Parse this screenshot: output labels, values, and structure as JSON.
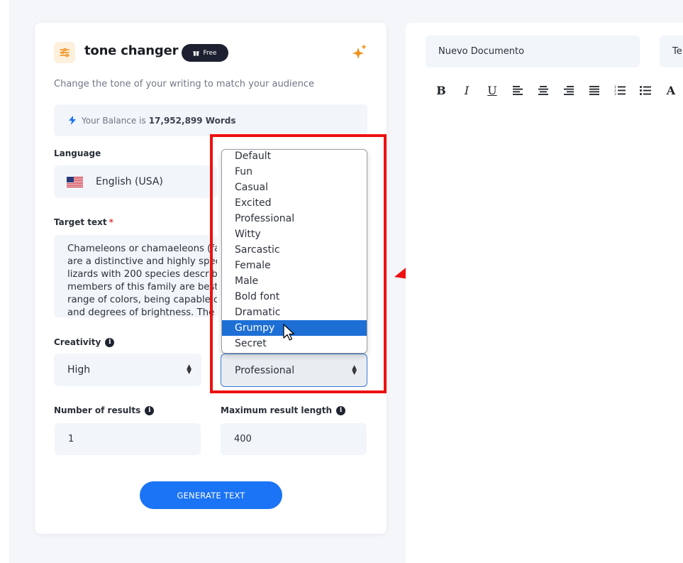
{
  "app": {
    "title": "tone changer",
    "badge": "Free",
    "subtitle": "Change the tone of your writing to match your audience"
  },
  "balance": {
    "prefix": "Your Balance is",
    "value": "17,952,899 Words"
  },
  "language": {
    "label": "Language",
    "value": "English (USA)"
  },
  "target_text": {
    "label": "Target text",
    "required_mark": "*",
    "lines": [
      "Chameleons or chamaeleons (fa",
      "are a distinctive and highly spec",
      "lizards with 200 species describ",
      "members of this family are best",
      "range of colors, being capable o",
      "and degrees of brightness. The l"
    ]
  },
  "creativity": {
    "label": "Creativity",
    "value": "High"
  },
  "tone": {
    "value": "Professional",
    "options": [
      "Default",
      "Fun",
      "Casual",
      "Excited",
      "Professional",
      "Witty",
      "Sarcastic",
      "Female",
      "Male",
      "Bold font",
      "Dramatic",
      "Grumpy",
      "Secret"
    ],
    "highlighted": "Grumpy"
  },
  "num_results": {
    "label": "Number of results",
    "value": "1"
  },
  "max_length": {
    "label": "Maximum result length",
    "value": "400"
  },
  "generate_label": "GENERATE TEXT",
  "editor": {
    "doc_title": "Nuevo Documento",
    "second_field": "Te",
    "toolbar": [
      "B",
      "I",
      "U",
      "align-left-icon",
      "align-center-icon",
      "align-right-icon",
      "align-justify-icon",
      "ordered-list-icon",
      "bullet-list-icon",
      "A"
    ]
  },
  "colors": {
    "accent": "#1b74f5",
    "highlight": "#1d6fd6",
    "annotation": "#ee1111"
  }
}
